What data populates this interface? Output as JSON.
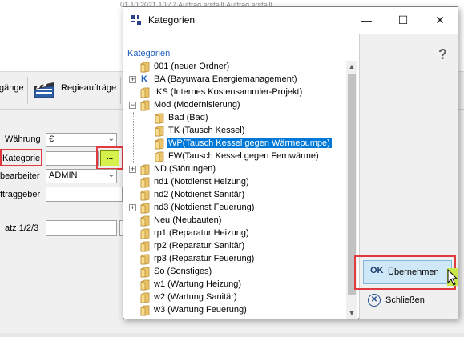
{
  "background": {
    "top_strip": "01 10 2021 10:47     Auftrag erstellt          Auftrag erstellt",
    "toolbar": {
      "left_label": "gänge",
      "regie_label": "Regieaufträge"
    },
    "form": {
      "waehrung_label": "Währung",
      "waehrung_value": "€",
      "kategorie_label": "Kategorie",
      "kategorie_value": "",
      "kategorie_button": "...",
      "bearbeiter_label": "bearbeiter",
      "bearbeiter_value": "ADMIN",
      "auftraggeber_label": "ftraggeber",
      "satz_label": "atz 1/2/3"
    }
  },
  "dialog": {
    "title": "Kategorien",
    "controls": {
      "minimize": "—",
      "maximize": "☐",
      "close": "✕"
    },
    "tree_header": "Kategorien",
    "tree": [
      {
        "label": "001 (neuer Ordner)",
        "level": 0,
        "expander": "",
        "icon": "folder"
      },
      {
        "label": "BA (Bayuwara Energiemanagement)",
        "level": 0,
        "expander": "+",
        "icon": "k-glyph"
      },
      {
        "label": "IKS (Internes Kostensammler-Projekt)",
        "level": 0,
        "expander": "",
        "icon": "folder"
      },
      {
        "label": "Mod (Modernisierung)",
        "level": 0,
        "expander": "−",
        "icon": "folder"
      },
      {
        "label": "Bad (Bad)",
        "level": 1,
        "expander": "",
        "icon": "folder"
      },
      {
        "label": "TK (Tausch Kessel)",
        "level": 1,
        "expander": "",
        "icon": "folder"
      },
      {
        "label": "WP(Tausch Kessel gegen Wärmepumpe)",
        "level": 1,
        "expander": "",
        "icon": "folder",
        "selected": true
      },
      {
        "label": "FW(Tausch Kessel gegen Fernwärme)",
        "level": 1,
        "expander": "",
        "icon": "folder"
      },
      {
        "label": "ND (Störungen)",
        "level": 0,
        "expander": "+",
        "icon": "folder"
      },
      {
        "label": "nd1 (Notdienst Heizung)",
        "level": 0,
        "expander": "",
        "icon": "folder"
      },
      {
        "label": "nd2 (Notdienst Sanitär)",
        "level": 0,
        "expander": "",
        "icon": "folder"
      },
      {
        "label": "nd3 (Notdienst Feuerung)",
        "level": 0,
        "expander": "+",
        "icon": "folder"
      },
      {
        "label": "Neu (Neubauten)",
        "level": 0,
        "expander": "",
        "icon": "folder"
      },
      {
        "label": "rp1 (Reparatur Heizung)",
        "level": 0,
        "expander": "",
        "icon": "folder"
      },
      {
        "label": "rp2 (Reparatur Sanitär)",
        "level": 0,
        "expander": "",
        "icon": "folder"
      },
      {
        "label": "rp3 (Reparatur Feuerung)",
        "level": 0,
        "expander": "",
        "icon": "folder"
      },
      {
        "label": "So (Sonstiges)",
        "level": 0,
        "expander": "",
        "icon": "folder"
      },
      {
        "label": "w1 (Wartung Heizung)",
        "level": 0,
        "expander": "",
        "icon": "folder"
      },
      {
        "label": "w2 (Wartung Sanitär)",
        "level": 0,
        "expander": "",
        "icon": "folder"
      },
      {
        "label": "w3 (Wartung Feuerung)",
        "level": 0,
        "expander": "",
        "icon": "folder"
      }
    ],
    "help": "?",
    "apply_icon": "OK",
    "apply_label": "Übernehmen",
    "close_icon": "✕",
    "close_label": "Schließen"
  },
  "colors": {
    "selection": "#0078d7",
    "annotation_red": "#e0393e",
    "highlight_yellow": "#d6f04c",
    "apply_button": "#cfe8f7"
  }
}
